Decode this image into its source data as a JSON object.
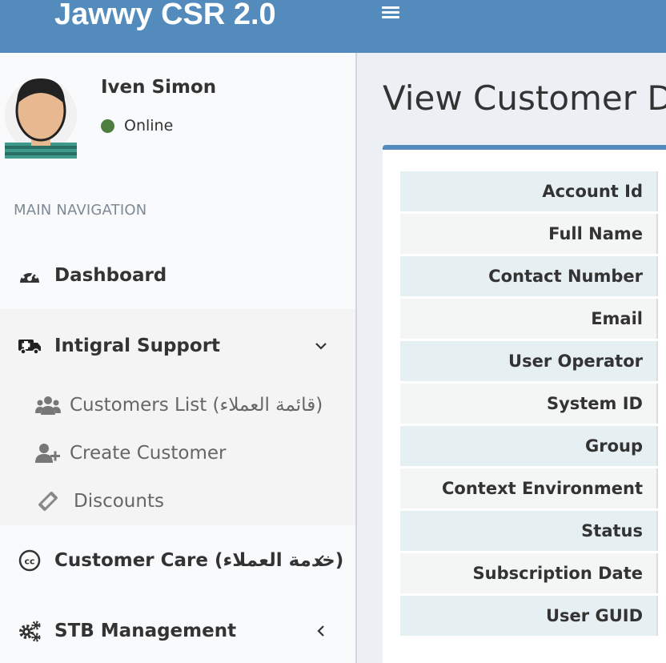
{
  "header": {
    "app_title": "Jawwy CSR 2.0",
    "menu_icon": "hamburger-icon"
  },
  "user": {
    "name": "Iven Simon",
    "status": "Online",
    "status_color": "#4d7d40"
  },
  "sidebar": {
    "nav_header": "MAIN NAVIGATION",
    "items": [
      {
        "label": "Dashboard",
        "icon": "dashboard-icon"
      },
      {
        "label": "Intigral Support",
        "icon": "ambulance-icon",
        "expanded": true,
        "children": [
          {
            "label": "Customers List (قائمة العملاء)",
            "icon": "users-icon"
          },
          {
            "label": "Create Customer",
            "icon": "user-plus-icon"
          },
          {
            "label": "Discounts",
            "icon": "ticket-icon"
          }
        ]
      },
      {
        "label": "Customer Care (خدمة العملاء)",
        "icon": "cc-icon"
      },
      {
        "label": "STB Management",
        "icon": "gears-icon"
      }
    ]
  },
  "main": {
    "title": "View Customer De",
    "fields": [
      "Account Id",
      "Full Name",
      "Contact Number",
      "Email",
      "User Operator",
      "System ID",
      "Group",
      "Context Environment",
      "Status",
      "Subscription Date",
      "User GUID"
    ]
  },
  "colors": {
    "brand": "#538bbd",
    "sidebar_bg": "#f9fafc",
    "content_bg": "#ecf0f5"
  }
}
